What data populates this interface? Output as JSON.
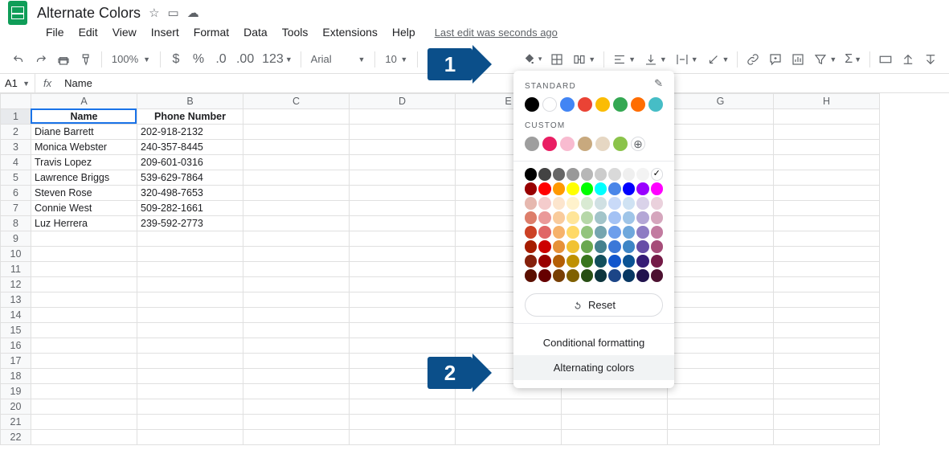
{
  "doc": {
    "title": "Alternate Colors"
  },
  "menubar": [
    "File",
    "Edit",
    "View",
    "Insert",
    "Format",
    "Data",
    "Tools",
    "Extensions",
    "Help"
  ],
  "last_edit": "Last edit was seconds ago",
  "toolbar": {
    "zoom": "100%",
    "font_name": "Arial",
    "font_size": "10"
  },
  "namebox": "A1",
  "formula_value": "Name",
  "columns": [
    "A",
    "B",
    "C",
    "D",
    "E",
    "F",
    "G",
    "H"
  ],
  "rows": 22,
  "headers": {
    "A": "Name",
    "B": "Phone Number"
  },
  "data": [
    {
      "A": "Diane Barrett",
      "B": "202-918-2132"
    },
    {
      "A": "Monica Webster",
      "B": "240-357-8445"
    },
    {
      "A": "Travis Lopez",
      "B": "209-601-0316"
    },
    {
      "A": "Lawrence Briggs",
      "B": "539-629-7864"
    },
    {
      "A": "Steven Rose",
      "B": "320-498-7653"
    },
    {
      "A": "Connie West",
      "B": "509-282-1661"
    },
    {
      "A": "Luz Herrera",
      "B": "239-592-2773"
    }
  ],
  "color_dropdown": {
    "standard_label": "STANDARD",
    "custom_label": "CUSTOM",
    "standard": [
      "#000000",
      "#ffffff",
      "#4285f4",
      "#ea4335",
      "#fbbc04",
      "#34a853",
      "#ff6d01",
      "#46bdc6"
    ],
    "custom": [
      "#9e9e9e",
      "#e91e63",
      "#f8bbd0",
      "#c8a97e",
      "#e6d7c3",
      "#8bc34a"
    ],
    "reset_label": "Reset",
    "conditional_label": "Conditional formatting",
    "alternating_label": "Alternating colors",
    "palette": [
      [
        "#000000",
        "#434343",
        "#666666",
        "#999999",
        "#b7b7b7",
        "#cccccc",
        "#d9d9d9",
        "#efefef",
        "#f3f3f3",
        "#ffffff"
      ],
      [
        "#980000",
        "#ff0000",
        "#ff9900",
        "#ffff00",
        "#00ff00",
        "#00ffff",
        "#4a86e8",
        "#0000ff",
        "#9900ff",
        "#ff00ff"
      ],
      [
        "#e6b8af",
        "#f4cccc",
        "#fce5cd",
        "#fff2cc",
        "#d9ead3",
        "#d0e0e3",
        "#c9daf8",
        "#cfe2f3",
        "#d9d2e9",
        "#ead1dc"
      ],
      [
        "#dd7e6b",
        "#ea9999",
        "#f9cb9c",
        "#ffe599",
        "#b6d7a8",
        "#a2c4c9",
        "#a4c2f4",
        "#9fc5e8",
        "#b4a7d6",
        "#d5a6bd"
      ],
      [
        "#cc4125",
        "#e06666",
        "#f6b26b",
        "#ffd966",
        "#93c47d",
        "#76a5af",
        "#6d9eeb",
        "#6fa8dc",
        "#8e7cc3",
        "#c27ba0"
      ],
      [
        "#a61c00",
        "#cc0000",
        "#e69138",
        "#f1c232",
        "#6aa84f",
        "#45818e",
        "#3c78d8",
        "#3d85c6",
        "#674ea7",
        "#a64d79"
      ],
      [
        "#85200c",
        "#990000",
        "#b45f06",
        "#bf9000",
        "#38761d",
        "#134f5c",
        "#1155cc",
        "#0b5394",
        "#351c75",
        "#741b47"
      ],
      [
        "#5b0f00",
        "#660000",
        "#783f04",
        "#7f6000",
        "#274e13",
        "#0c343d",
        "#1c4587",
        "#073763",
        "#20124d",
        "#4c1130"
      ]
    ]
  },
  "callouts": {
    "one": "1",
    "two": "2"
  }
}
